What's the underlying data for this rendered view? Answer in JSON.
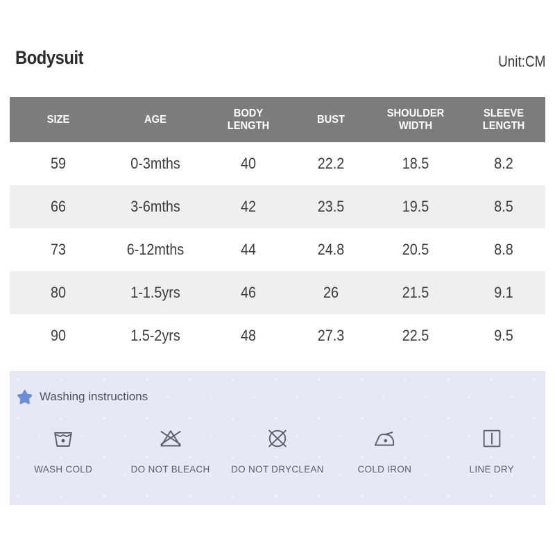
{
  "header": {
    "product_title": "Bodysuit",
    "unit_label": "Unit:CM"
  },
  "size_chart": {
    "columns": [
      {
        "label": "SIZE",
        "key": "size"
      },
      {
        "label": "AGE",
        "key": "age"
      },
      {
        "label": "BODY\nLENGTH",
        "key": "body_length"
      },
      {
        "label": "BUST",
        "key": "bust"
      },
      {
        "label": "SHOULDER\nWIDTH",
        "key": "shoulder_width"
      },
      {
        "label": "SLEEVE\nLENGTH",
        "key": "sleeve_length"
      }
    ],
    "rows": [
      {
        "size": "59",
        "age": "0-3mths",
        "body_length": "40",
        "bust": "22.2",
        "shoulder_width": "18.5",
        "sleeve_length": "8.2"
      },
      {
        "size": "66",
        "age": "3-6mths",
        "body_length": "42",
        "bust": "23.5",
        "shoulder_width": "19.5",
        "sleeve_length": "8.5"
      },
      {
        "size": "73",
        "age": "6-12mths",
        "body_length": "44",
        "bust": "24.8",
        "shoulder_width": "20.5",
        "sleeve_length": "8.8"
      },
      {
        "size": "80",
        "age": "1-1.5yrs",
        "body_length": "46",
        "bust": "26",
        "shoulder_width": "21.5",
        "sleeve_length": "9.1"
      },
      {
        "size": "90",
        "age": "1.5-2yrs",
        "body_length": "48",
        "bust": "27.3",
        "shoulder_width": "22.5",
        "sleeve_length": "9.5"
      }
    ]
  },
  "washing": {
    "heading": "Washing instructions",
    "star_icon": "star-icon",
    "items": [
      {
        "label": "WASH COLD",
        "icon": "wash-tub-one-dot-icon"
      },
      {
        "label": "DO NOT BLEACH",
        "icon": "crossed-triangle-icon"
      },
      {
        "label": "DO NOT DRYCLEAN",
        "icon": "crossed-circle-icon"
      },
      {
        "label": "COLD IRON",
        "icon": "iron-one-dot-icon"
      },
      {
        "label": "LINE DRY",
        "icon": "square-vertical-line-icon"
      }
    ]
  },
  "colors": {
    "header_gray": "#7c7c7c",
    "stripe_gray": "#efefef",
    "panel_lavender": "#e6e9f5",
    "star_blue": "#6b8fd4",
    "icon_stroke": "#5a5f6b",
    "text_dark": "#3c3c3c"
  }
}
